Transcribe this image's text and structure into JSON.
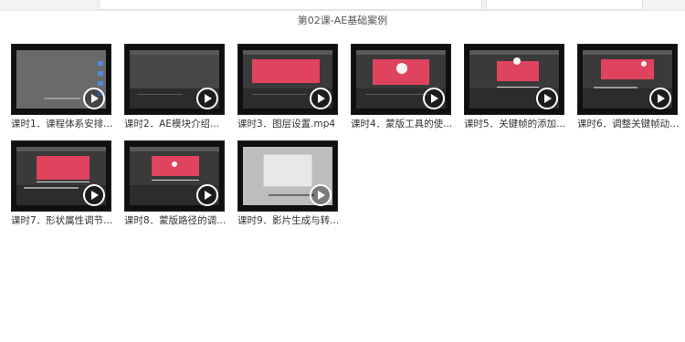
{
  "breadcrumb": "第02课-AE基础案例",
  "items": [
    {
      "caption": "课时1．课程体系安排..."
    },
    {
      "caption": "课时2．AE模块介绍..."
    },
    {
      "caption": "课时3．图层设置.mp4"
    },
    {
      "caption": "课时4．蒙版工具的使..."
    },
    {
      "caption": "课时5．关键帧的添加..."
    },
    {
      "caption": "课时6．调整关键帧动..."
    },
    {
      "caption": "课时7．形状属性调节..."
    },
    {
      "caption": "课时8．蒙版路径的调..."
    },
    {
      "caption": "课时9．影片生成与转..."
    }
  ],
  "icons": {
    "play": "play-icon"
  },
  "colors": {
    "accent_canvas": "#e0435e",
    "panel": "#3a3a3a",
    "caption_text": "#333333"
  }
}
